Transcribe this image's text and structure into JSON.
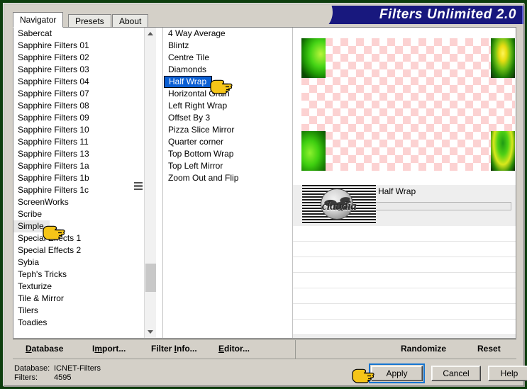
{
  "window": {
    "title": "Filters Unlimited 2.0"
  },
  "tabs": [
    {
      "label": "Navigator",
      "active": true
    },
    {
      "label": "Presets",
      "active": false
    },
    {
      "label": "About",
      "active": false
    }
  ],
  "categories": {
    "items": [
      "Sabercat",
      "Sapphire Filters 01",
      "Sapphire Filters 02",
      "Sapphire Filters 03",
      "Sapphire Filters 04",
      "Sapphire Filters 07",
      "Sapphire Filters 08",
      "Sapphire Filters 09",
      "Sapphire Filters 10",
      "Sapphire Filters 11",
      "Sapphire Filters 13",
      "Sapphire Filters 1a",
      "Sapphire Filters 1b",
      "Sapphire Filters 1c",
      "ScreenWorks",
      "Scribe",
      "Simple",
      "Special Effects 1",
      "Special Effects 2",
      "Sybia",
      "Teph's Tricks",
      "Texturize",
      "Tile & Mirror",
      "Tilers",
      "Toadies"
    ],
    "selected": "Simple",
    "selected_index": 16
  },
  "filters": {
    "items": [
      "4 Way Average",
      "Blintz",
      "Centre Tile",
      "Diamonds",
      "Half Wrap",
      "Horizontal Grain",
      "Left Right Wrap",
      "Offset By 3",
      "Pizza Slice Mirror",
      "Quarter corner",
      "Top Bottom Wrap",
      "Top Left Mirror",
      "Zoom Out and Flip"
    ],
    "selected": "Half Wrap",
    "selected_index": 4
  },
  "parameters": {
    "title": "Half Wrap",
    "logo_text": "claudia"
  },
  "menu": [
    {
      "label": "Database",
      "accel": "D"
    },
    {
      "label": "Import...",
      "accel": "m"
    },
    {
      "label": "Filter Info...",
      "accel": "I"
    },
    {
      "label": "Editor...",
      "accel": "E"
    },
    {
      "label": "Randomize",
      "accel": ""
    },
    {
      "label": "Reset",
      "accel": ""
    }
  ],
  "status": {
    "database_label": "Database:",
    "database_value": "ICNET-Filters",
    "filters_label": "Filters:",
    "filters_value": "4595"
  },
  "buttons": {
    "apply": "Apply",
    "cancel": "Cancel",
    "help": "Help"
  },
  "icons": {
    "scroll_up": "scroll-up-arrow-icon",
    "scroll_down": "scroll-down-arrow-icon",
    "cursor": "hand-pointer-cursor-icon"
  },
  "colors": {
    "banner_bg": "#18187e",
    "selection_blue": "#0a5fd4",
    "focus_blue": "#1675d1",
    "window_bg": "#d4d0c8",
    "frame_green": "#0d3d0d",
    "checker_pink": "#fcd2d2"
  }
}
